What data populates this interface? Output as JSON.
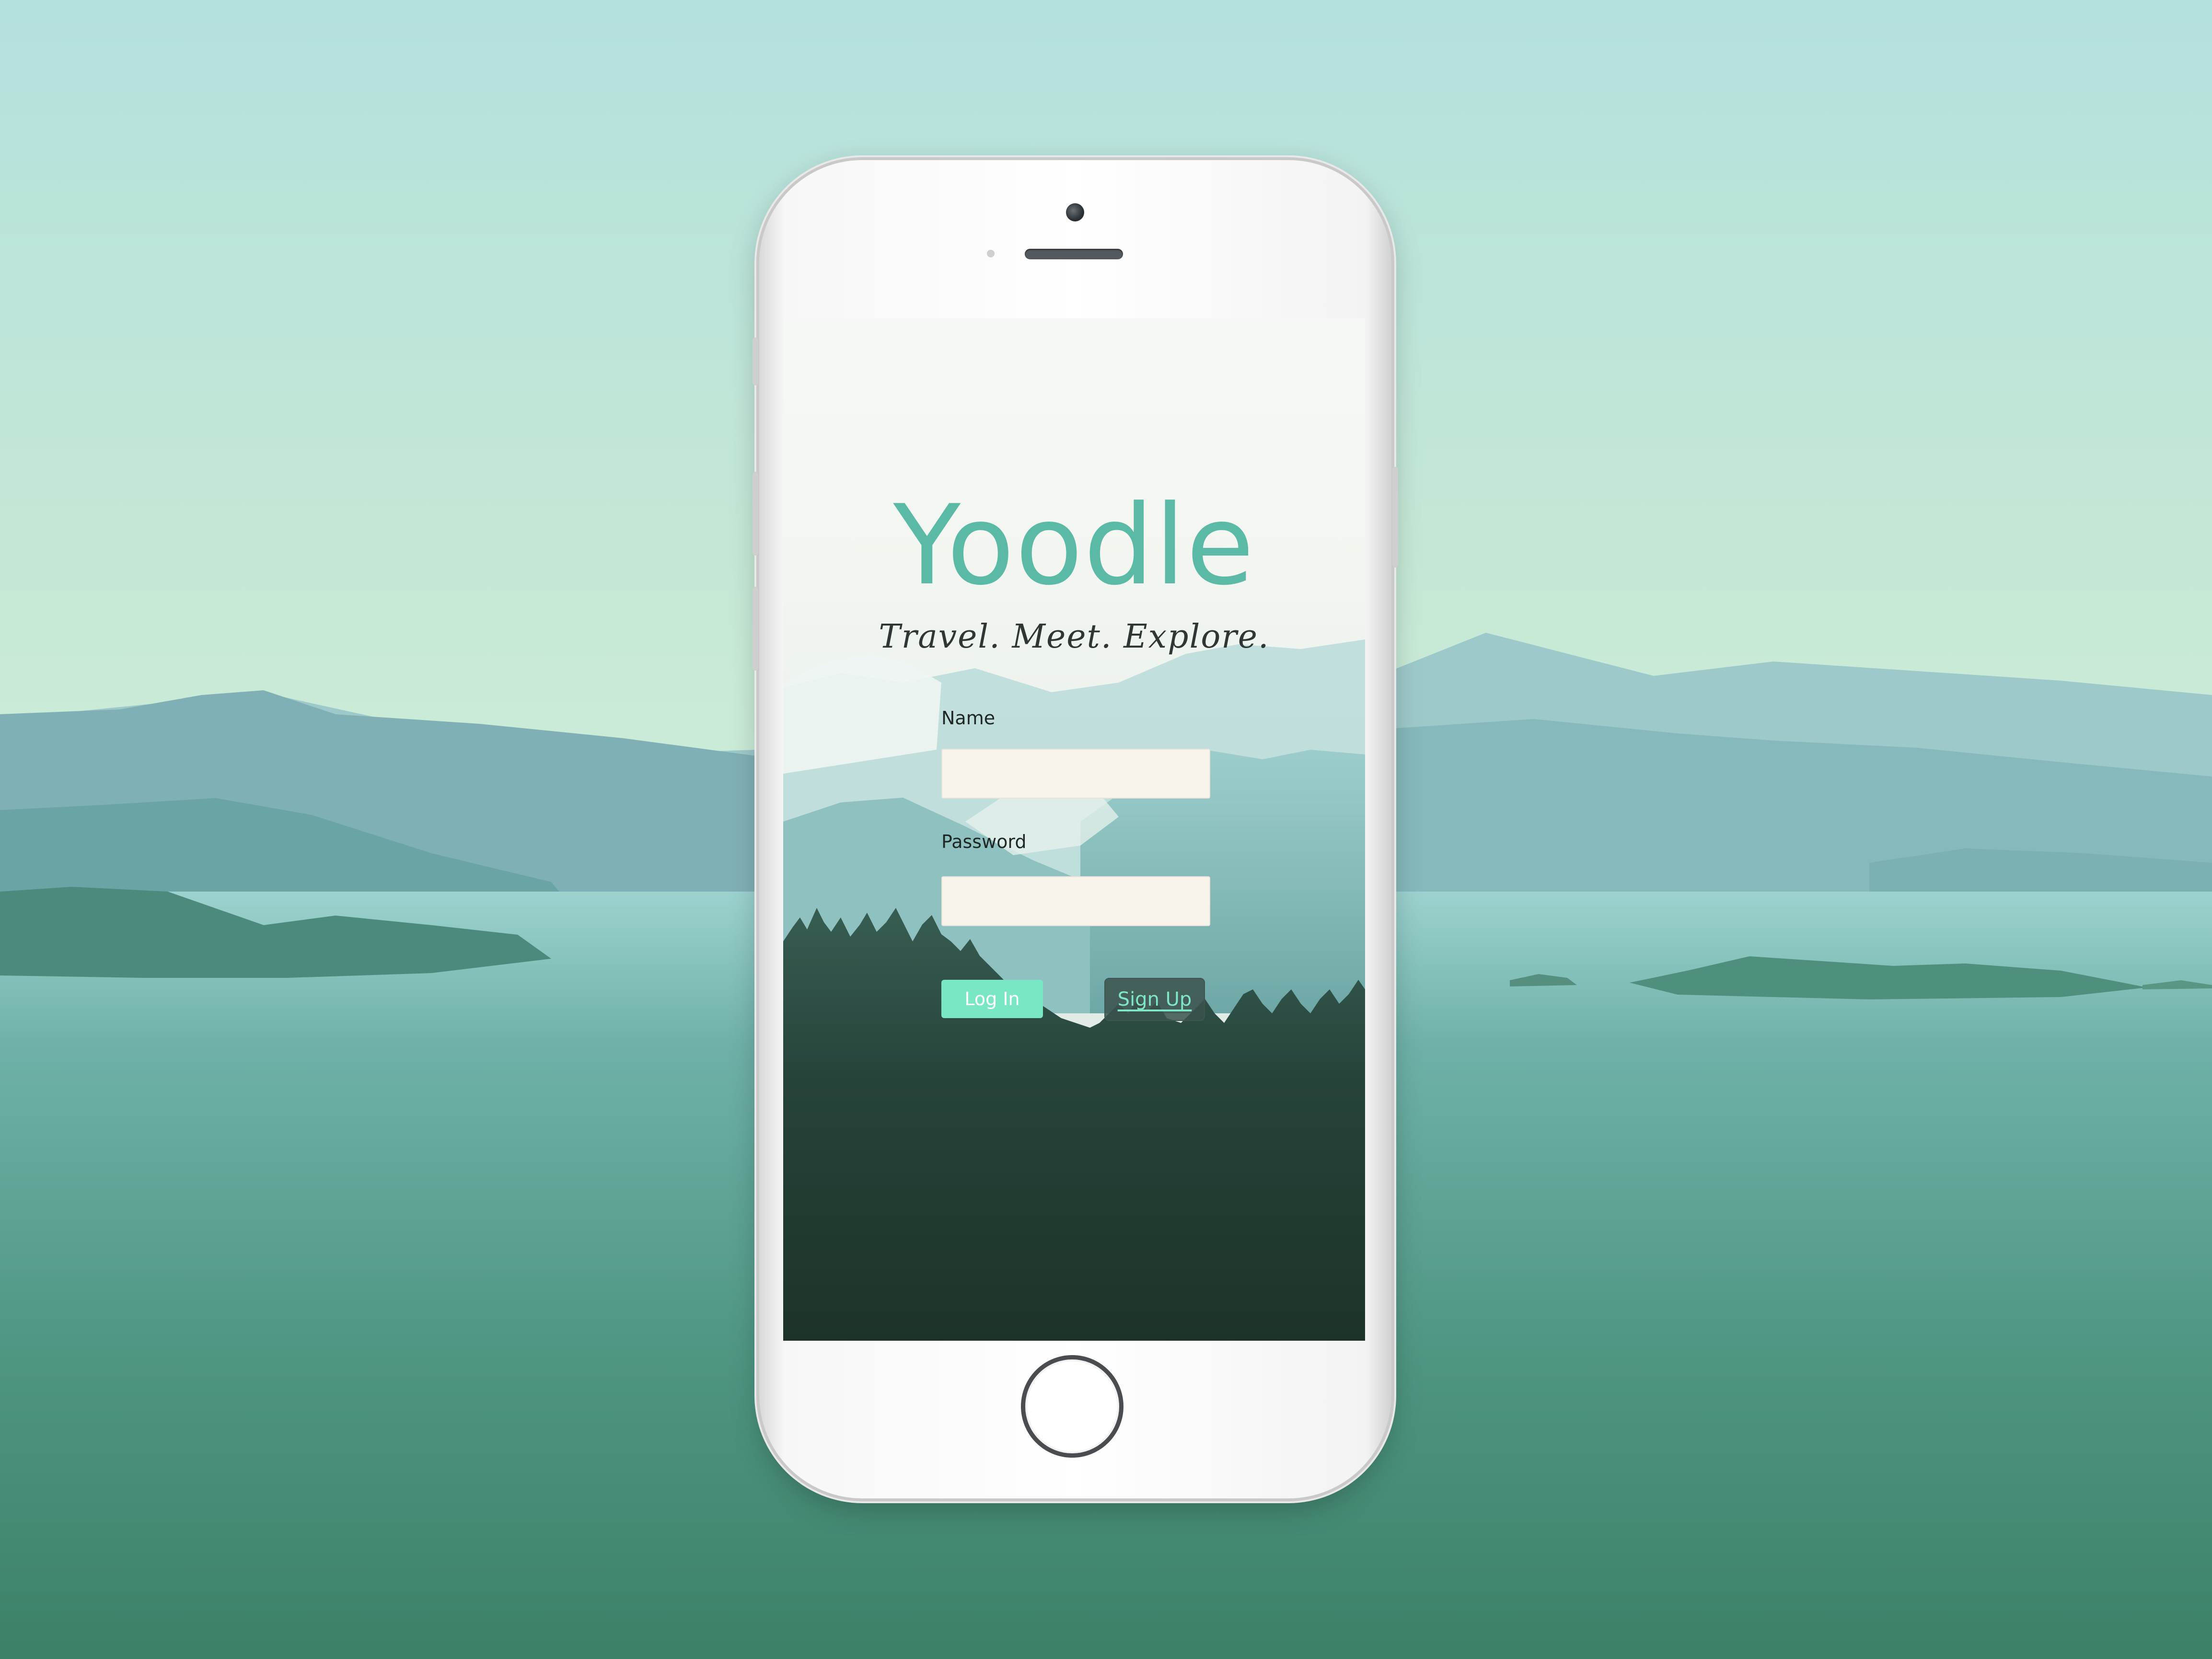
{
  "app": {
    "name": "Yoodle",
    "tagline": "Travel. Meet. Explore."
  },
  "login_form": {
    "name_label": "Name",
    "name_value": "",
    "password_label": "Password",
    "password_value": "",
    "login_label": "Log In",
    "signup_label": "Sign Up"
  },
  "colors": {
    "brand": "#5bbaa5",
    "login_button": "#79e7c6",
    "signup_text": "#7fe6c6",
    "input_fill": "#f8f4ec"
  }
}
